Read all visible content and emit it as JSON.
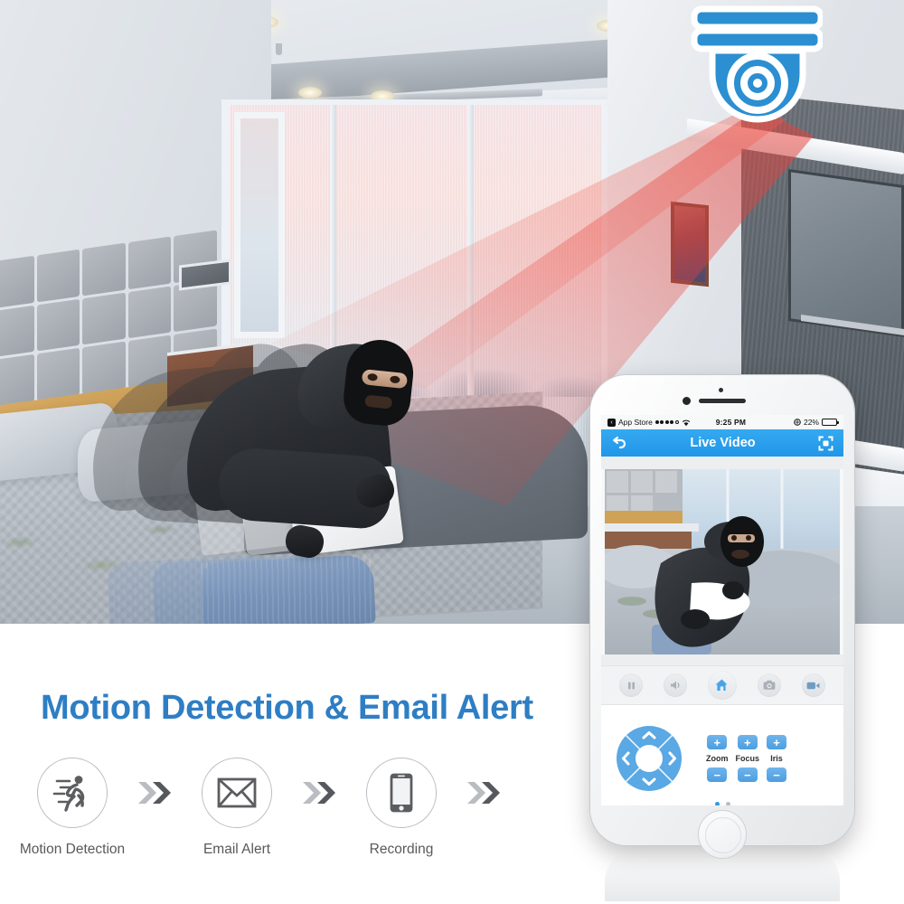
{
  "promo": {
    "headline": "Motion Detection & Email Alert",
    "headline_color": "#2e7ec4",
    "features": [
      {
        "label": "Motion Detection",
        "icon": "running-person-icon"
      },
      {
        "label": "Email Alert",
        "icon": "envelope-icon"
      },
      {
        "label": "Recording",
        "icon": "smartphone-icon"
      }
    ],
    "arrow_icon": "double-chevron-right-icon"
  },
  "camera_badge": {
    "icon": "dome-security-camera-icon",
    "color": "#2b8fd1"
  },
  "scene": {
    "description": "Bedroom at dusk with masked burglar carrying a laptop",
    "detection_cone_color": "#e8403a"
  },
  "phone": {
    "device": "iphone",
    "statusbar": {
      "back_app": "App Store",
      "back_icon": "back-chevron-icon",
      "signal_icon": "signal-dots-icon",
      "wifi_icon": "wifi-icon",
      "time": "9:25 PM",
      "location_icon": "location-services-icon",
      "battery_percent": "22%",
      "battery_icon": "battery-low-icon"
    },
    "app": {
      "header": {
        "back_icon": "undo-arrow-icon",
        "title": "Live Video",
        "fullscreen_icon": "fullscreen-expand-icon"
      },
      "video": {
        "label": "live-video-feed"
      },
      "toolbar": [
        {
          "name": "pause-button",
          "icon": "pause-icon",
          "state": "inactive"
        },
        {
          "name": "audio-button",
          "icon": "speaker-icon",
          "state": "inactive"
        },
        {
          "name": "home-button",
          "icon": "home-icon",
          "state": "active"
        },
        {
          "name": "snapshot-button",
          "icon": "camera-icon",
          "state": "inactive"
        },
        {
          "name": "record-button",
          "icon": "video-camera-icon",
          "state": "inactive"
        }
      ],
      "dpad": {
        "up_icon": "chevron-up-icon",
        "down_icon": "chevron-down-icon",
        "left_icon": "chevron-left-icon",
        "right_icon": "chevron-right-icon"
      },
      "ptz_controls": [
        {
          "label": "Zoom",
          "plus": "+",
          "minus": "−"
        },
        {
          "label": "Focus",
          "plus": "+",
          "minus": "−"
        },
        {
          "label": "Iris",
          "plus": "+",
          "minus": "−"
        }
      ],
      "page_dots": {
        "count": 2,
        "active_index": 0
      }
    }
  }
}
